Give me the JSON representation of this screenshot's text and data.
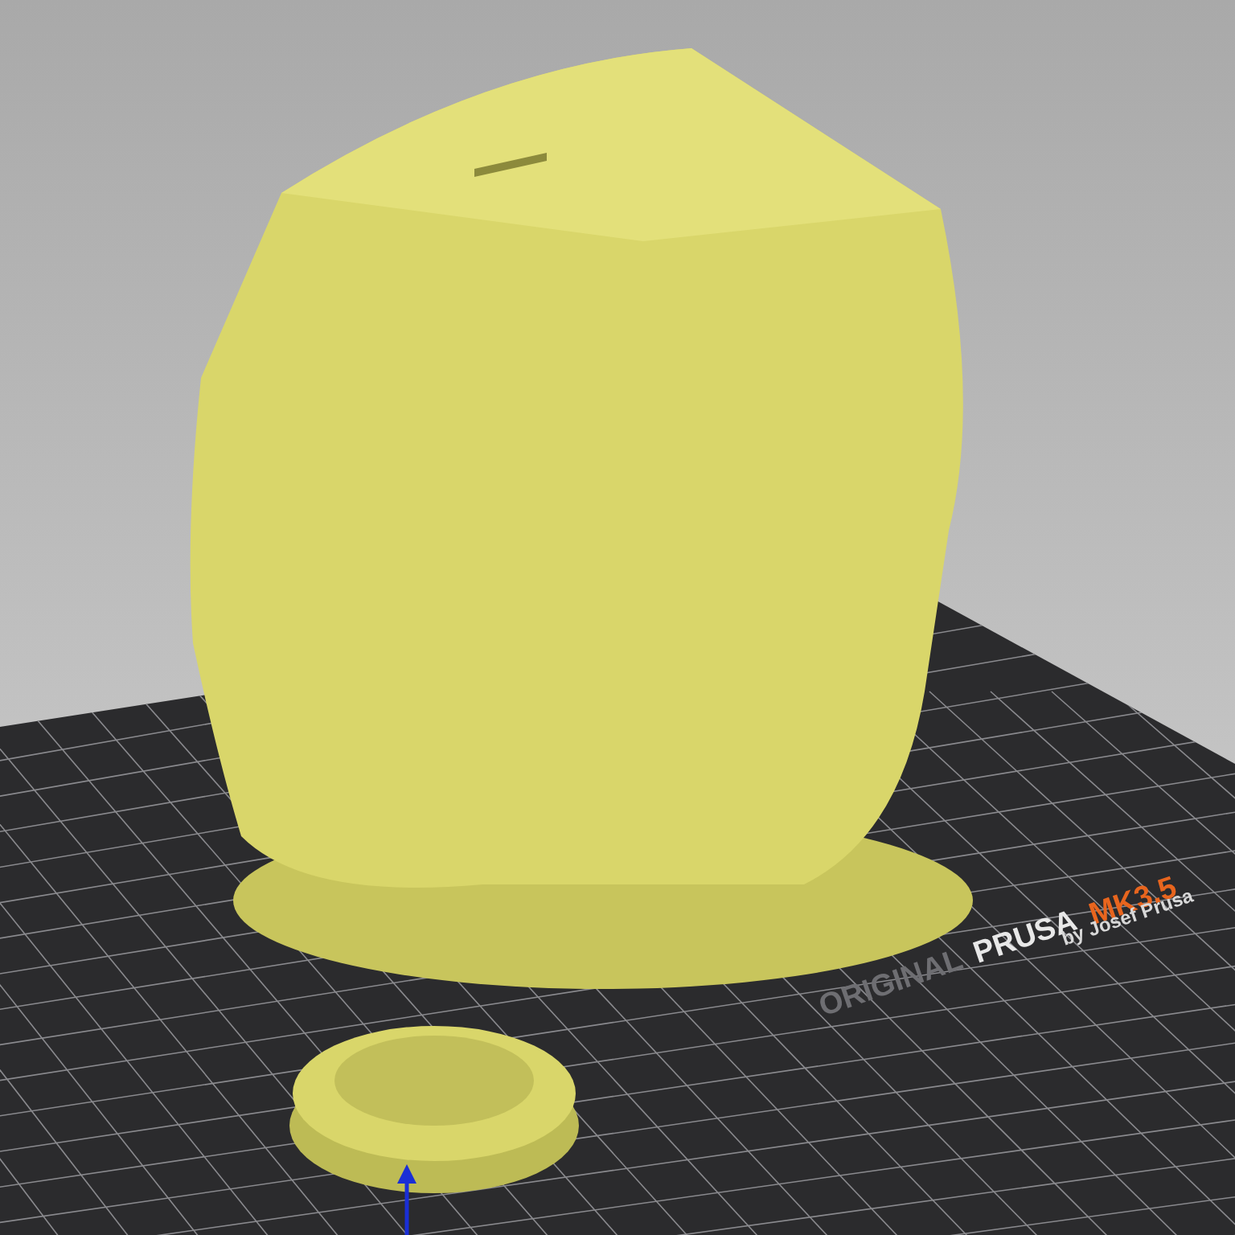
{
  "bed": {
    "brand_prefix": "ORIGINAL",
    "brand": "PRUSA",
    "model": "MK3.5",
    "maker": "by Josef Prusa"
  }
}
